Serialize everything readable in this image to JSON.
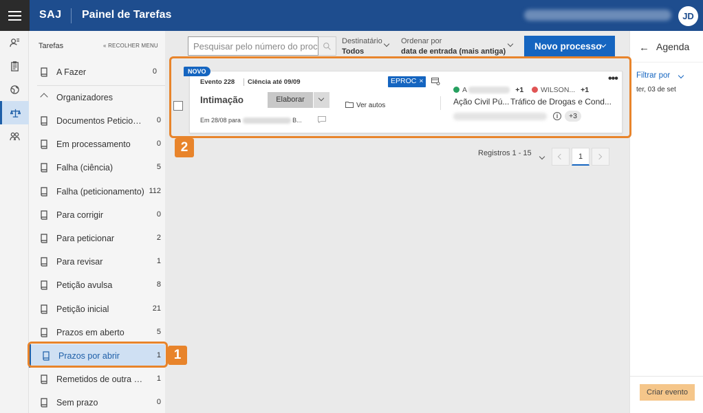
{
  "header": {
    "brand": "SAJ",
    "title": "Painel de Tarefas",
    "avatar_initials": "JD",
    "brand_color": "#1e4d8e"
  },
  "sidebar": {
    "section_label": "Tarefas",
    "collapse_label": "« RECOLHER MENU",
    "top_item": {
      "label": "A Fazer",
      "count": "0"
    },
    "group_label": "Organizadores",
    "items": [
      {
        "label": "Documentos Peticionados",
        "count": "0"
      },
      {
        "label": "Em processamento",
        "count": "0"
      },
      {
        "label": "Falha (ciência)",
        "count": "5"
      },
      {
        "label": "Falha (peticionamento)",
        "count": "112"
      },
      {
        "label": "Para corrigir",
        "count": "0"
      },
      {
        "label": "Para peticionar",
        "count": "2"
      },
      {
        "label": "Para revisar",
        "count": "1"
      },
      {
        "label": "Petição avulsa",
        "count": "8"
      },
      {
        "label": "Petição inicial",
        "count": "21"
      },
      {
        "label": "Prazos em aberto",
        "count": "5"
      },
      {
        "label": "Prazos por abrir",
        "count": "1",
        "active": true
      },
      {
        "label": "Remetidos de outra DP",
        "count": "1"
      },
      {
        "label": "Sem prazo",
        "count": "0"
      }
    ]
  },
  "toolbar": {
    "search_placeholder": "Pesquisar pelo número do processo",
    "recipient_label": "Destinatário",
    "recipient_value": "Todos",
    "sort_label": "Ordenar por",
    "sort_value": "data de entrada (mais antiga)",
    "new_process_label": "Novo processo"
  },
  "card": {
    "badge": "NOVO",
    "event": "Evento 228",
    "ciencia": "Ciência até 09/09",
    "system_tag": "EPROC",
    "system_tag_close": "×",
    "type": "Intimação",
    "elaborar_label": "Elaborar",
    "ver_autos_label": "Ver autos",
    "date_prefix": "Em 28/08 para",
    "date_suffix": "B...",
    "party_active_initial": "A",
    "party_active_more": "+1",
    "party_passive_name": "WILSON...",
    "party_passive_more": "+1",
    "classe": "Ação Civil Pú...",
    "assunto": "Tráfico de Drogas e Cond...",
    "more_count": "+3",
    "info_label": "i",
    "more_menu": "•••"
  },
  "pager": {
    "records_label": "Registros 1 - 15",
    "current_page": "1"
  },
  "agenda": {
    "back_label": "←",
    "title": "Agenda",
    "filter_label": "Filtrar por",
    "date": "ter, 03 de set",
    "create_event_label": "Criar evento"
  },
  "callouts": {
    "one": "1",
    "two": "2"
  },
  "colors": {
    "accent": "#1565c0",
    "callout": "#e8842b",
    "active_green": "#27a060",
    "passive_red": "#e05555"
  }
}
